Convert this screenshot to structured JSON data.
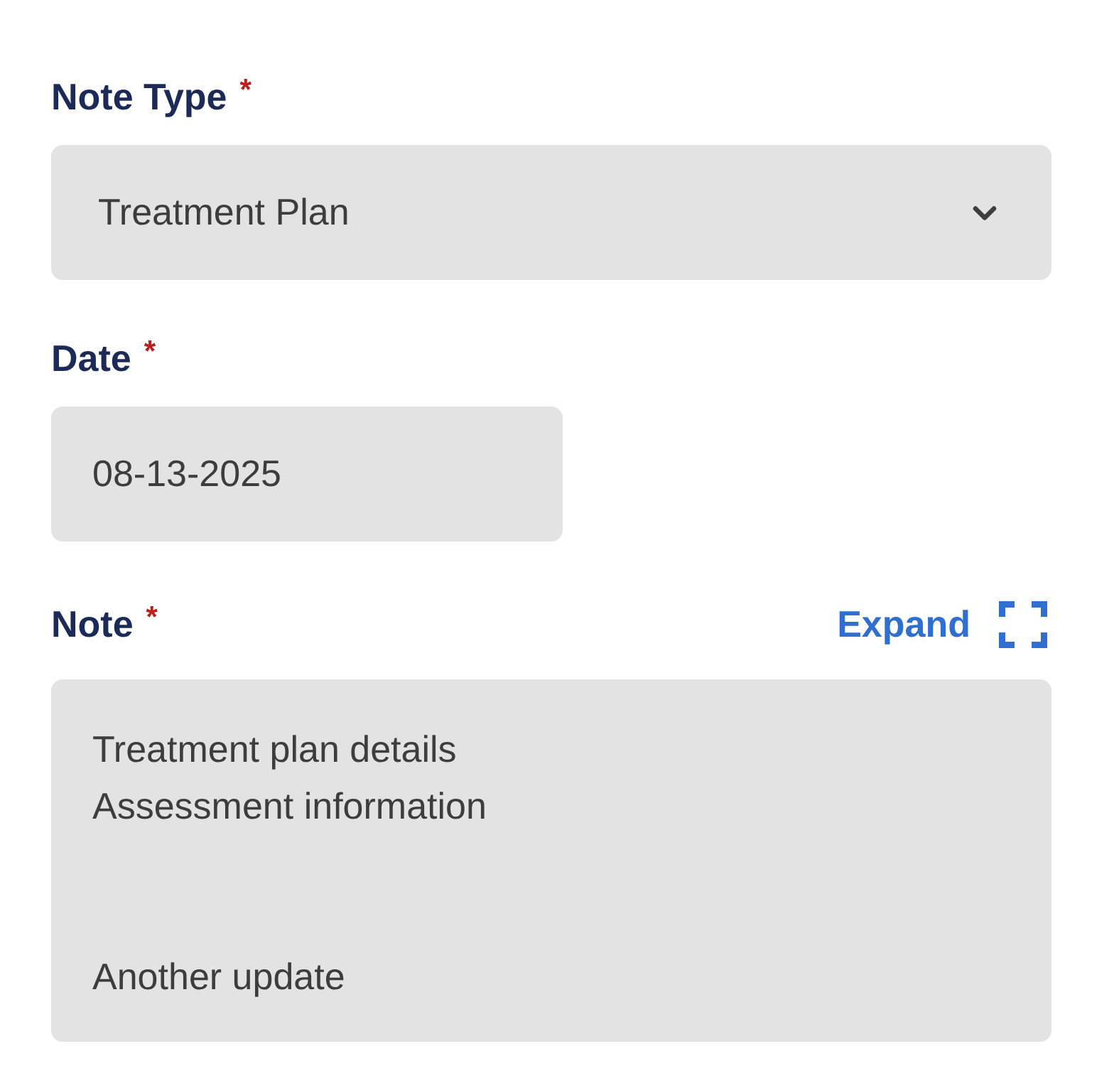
{
  "fields": [
    {
      "kind": "select",
      "label": "Note Type",
      "required_mark": "*",
      "value": "Treatment Plan"
    },
    {
      "kind": "date",
      "label": "Date",
      "required_mark": "*",
      "value": "08-13-2025"
    },
    {
      "kind": "textarea",
      "label": "Note",
      "required_mark": "*",
      "value": "Treatment plan details\nAssessment information\n\n\nAnother update",
      "action": {
        "label": "Expand"
      }
    }
  ]
}
